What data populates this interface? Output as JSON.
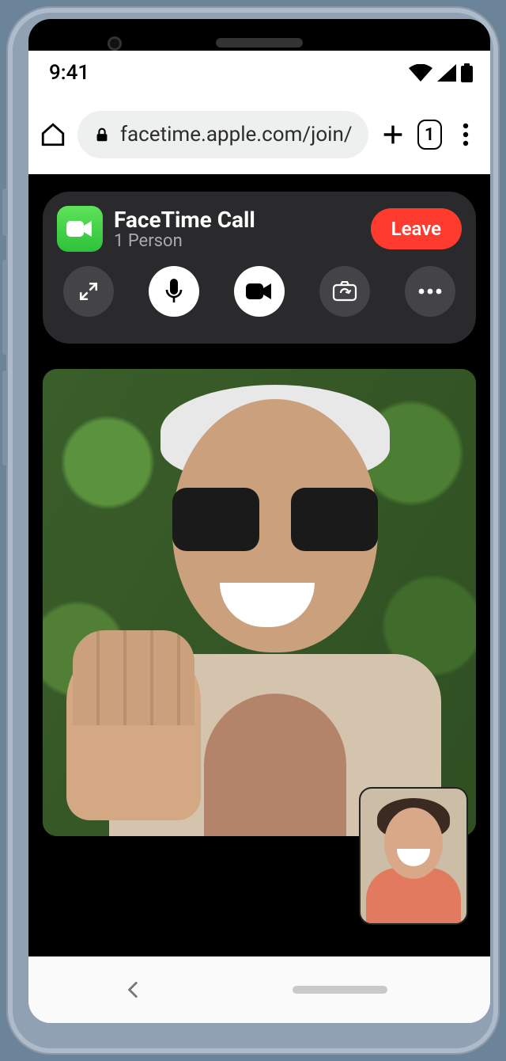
{
  "statusbar": {
    "time": "9:41"
  },
  "browser": {
    "url": "facetime.apple.com/join/",
    "tab_count": "1"
  },
  "call": {
    "title": "FaceTime Call",
    "subtitle": "1 Person",
    "leave_label": "Leave"
  }
}
